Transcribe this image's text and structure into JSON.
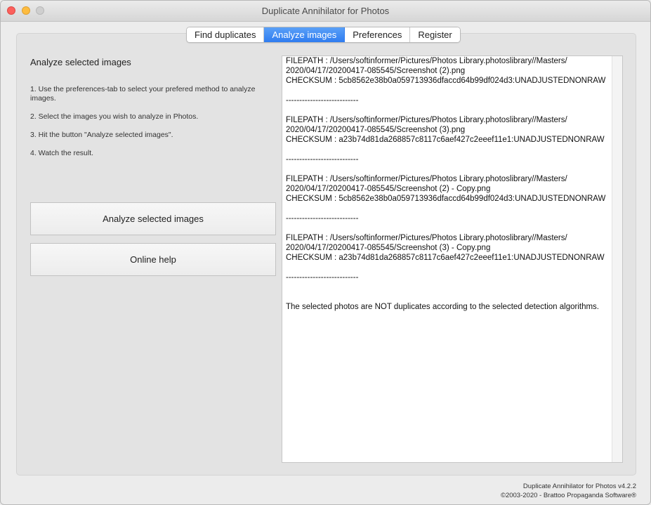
{
  "window": {
    "title": "Duplicate Annihilator for Photos"
  },
  "tabs": [
    {
      "label": "Find duplicates",
      "active": false
    },
    {
      "label": "Analyze images",
      "active": true
    },
    {
      "label": "Preferences",
      "active": false
    },
    {
      "label": "Register",
      "active": false
    }
  ],
  "left": {
    "heading": "Analyze selected images",
    "steps": [
      "1. Use the preferences-tab to select your prefered method to analyze images.",
      "2. Select the images you wish to analyze in Photos.",
      "3. Hit the button \"Analyze selected images\".",
      "4. Watch the result."
    ],
    "analyze_button": "Analyze selected images",
    "help_button": "Online help"
  },
  "result": {
    "text": "FILEPATH : /Users/softinformer/Pictures/Photos Library.photoslibrary//Masters/\n2020/04/17/20200417-085545/Screenshot (2).png\nCHECKSUM : 5cb8562e38b0a059713936dfaccd64b99df024d3:UNADJUSTEDNONRAW\n\n---------------------------\n\nFILEPATH : /Users/softinformer/Pictures/Photos Library.photoslibrary//Masters/\n2020/04/17/20200417-085545/Screenshot (3).png\nCHECKSUM : a23b74d81da268857c8117c6aef427c2eeef11e1:UNADJUSTEDNONRAW\n\n---------------------------\n\nFILEPATH : /Users/softinformer/Pictures/Photos Library.photoslibrary//Masters/\n2020/04/17/20200417-085545/Screenshot (2) - Copy.png\nCHECKSUM : 5cb8562e38b0a059713936dfaccd64b99df024d3:UNADJUSTEDNONRAW\n\n---------------------------\n\nFILEPATH : /Users/softinformer/Pictures/Photos Library.photoslibrary//Masters/\n2020/04/17/20200417-085545/Screenshot (3) - Copy.png\nCHECKSUM : a23b74d81da268857c8117c6aef427c2eeef11e1:UNADJUSTEDNONRAW\n\n---------------------------\n\n\nThe selected photos are NOT duplicates according to the selected detection algorithms."
  },
  "footer": {
    "version": "Duplicate Annihilator for Photos v4.2.2",
    "copyright": "©2003-2020 - Brattoo Propaganda Software®"
  },
  "colors": {
    "accent": "#2f7cf0",
    "close": "#fc605c",
    "minimize": "#fdbc40",
    "maximize": "#cfcfcf"
  }
}
